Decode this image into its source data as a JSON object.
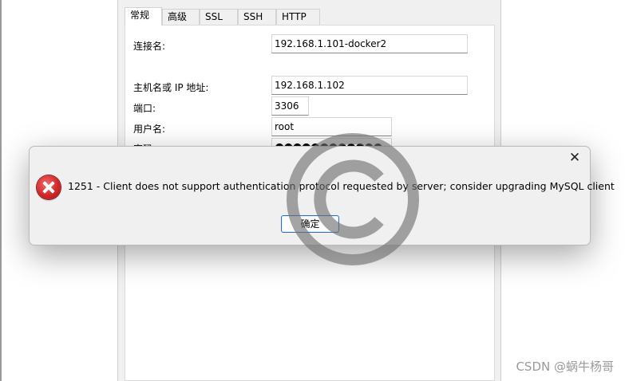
{
  "connection_dialog": {
    "tabs": [
      "常规",
      "高级",
      "SSL",
      "SSH",
      "HTTP"
    ],
    "active_tab": "常规",
    "fields": {
      "connection_name": {
        "label": "连接名:",
        "value": "192.168.1.101-docker2"
      },
      "host": {
        "label": "主机名或 IP 地址:",
        "value": "192.168.1.102"
      },
      "port": {
        "label": "端口:",
        "value": "3306"
      },
      "username": {
        "label": "用户名:",
        "value": "root"
      },
      "password": {
        "label": "密码",
        "value": "●●●●●●●●●●●●"
      }
    }
  },
  "error_dialog": {
    "close_glyph": "✕",
    "message": "1251 - Client does not support authentication protocol requested by server; consider upgrading MySQL client",
    "ok_label": "确定"
  },
  "watermark": {
    "credit": "CSDN @蜗牛杨哥"
  }
}
